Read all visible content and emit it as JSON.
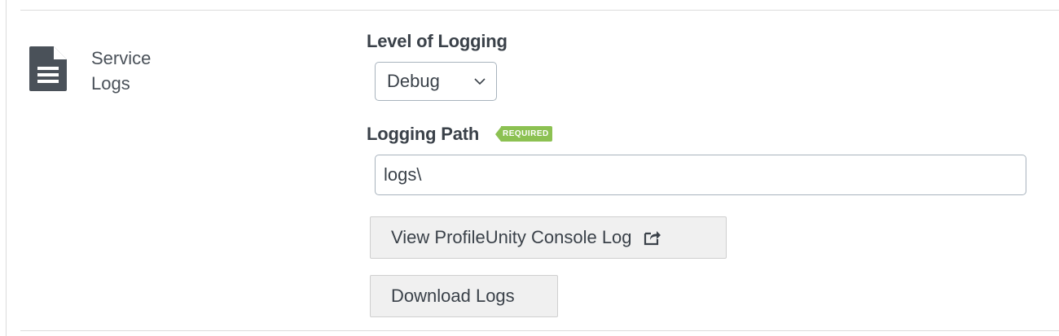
{
  "section": {
    "title_line1": "Service",
    "title_line2": "Logs",
    "icon": "document-icon"
  },
  "logging_level": {
    "label": "Level of Logging",
    "selected": "Debug"
  },
  "logging_path": {
    "label": "Logging Path",
    "required_badge": "REQUIRED",
    "value": "logs\\"
  },
  "buttons": {
    "view_console_log": "View ProfileUnity Console Log",
    "view_console_log_icon": "external-link-icon",
    "download_logs": "Download Logs"
  },
  "colors": {
    "required_badge": "#8cc152",
    "icon": "#4a5159",
    "button_bg": "#f0f0f0"
  }
}
